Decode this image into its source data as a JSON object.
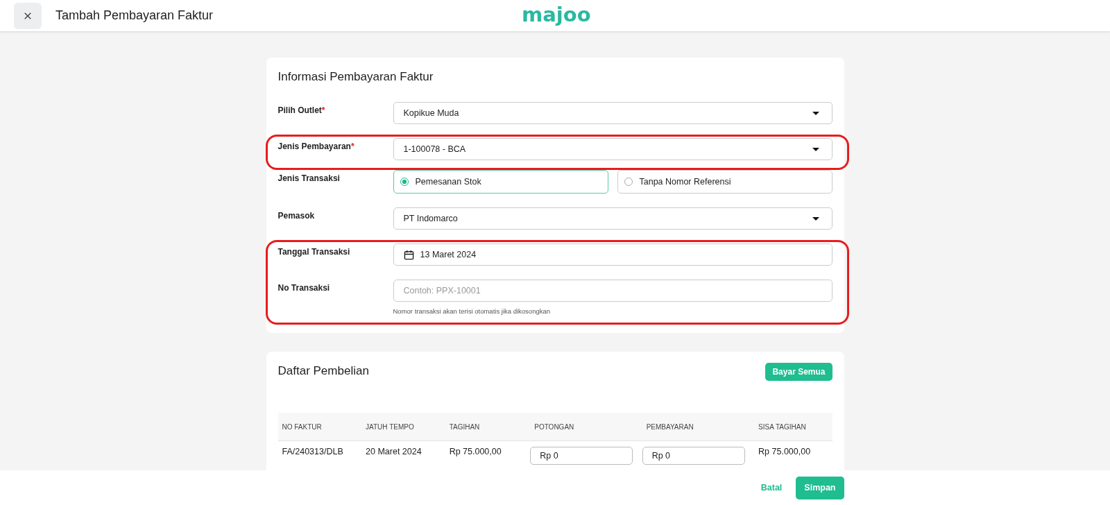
{
  "header": {
    "title": "Tambah Pembayaran Faktur",
    "logo": "majoo"
  },
  "info_card": {
    "title": "Informasi Pembayaran Faktur",
    "sections": [
      {
        "highlighted": false,
        "fields": [
          {
            "kind": "select",
            "label": "Pilih Outlet",
            "required_mark": "*",
            "value": "Kopikue Muda"
          }
        ]
      },
      {
        "highlighted": true,
        "fields": [
          {
            "kind": "select",
            "label": "Jenis Pembayaran",
            "required_mark": "*",
            "value": "1-100078 - BCA"
          }
        ]
      },
      {
        "highlighted": false,
        "fields": [
          {
            "kind": "radio",
            "label": "Jenis Transaksi",
            "options": [
              {
                "label": "Pemesanan Stok",
                "selected": true
              },
              {
                "label": "Tanpa Nomor Referensi",
                "selected": false
              }
            ]
          },
          {
            "kind": "select",
            "label": "Pemasok",
            "value": "PT Indomarco"
          }
        ]
      },
      {
        "highlighted": true,
        "fields": [
          {
            "kind": "date",
            "label": "Tanggal Transaksi",
            "value": "13 Maret 2024"
          },
          {
            "kind": "text",
            "label": "No Transaksi",
            "placeholder": "Contoh: PPX-10001",
            "hint": "Nomor transaksi akan terisi otomatis jika dikosongkan"
          }
        ]
      }
    ]
  },
  "purchase_card": {
    "title": "Daftar Pembelian",
    "action": "Bayar Semua",
    "columns": [
      "NO FAKTUR",
      "JATUH TEMPO",
      "TAGIHAN",
      "POTONGAN",
      "PEMBAYARAN",
      "SISA TAGIHAN"
    ],
    "rows": [
      [
        {
          "kind": "text",
          "value": "FA/240313/DLB"
        },
        {
          "kind": "text",
          "value": "20 Maret 2024"
        },
        {
          "kind": "text",
          "value": "Rp 75.000,00"
        },
        {
          "kind": "input",
          "value": "Rp 0"
        },
        {
          "kind": "input",
          "value": "Rp 0"
        },
        {
          "kind": "text",
          "value": "Rp 75.000,00"
        }
      ]
    ]
  },
  "footer": {
    "cancel": "Batal",
    "save": "Simpan"
  }
}
